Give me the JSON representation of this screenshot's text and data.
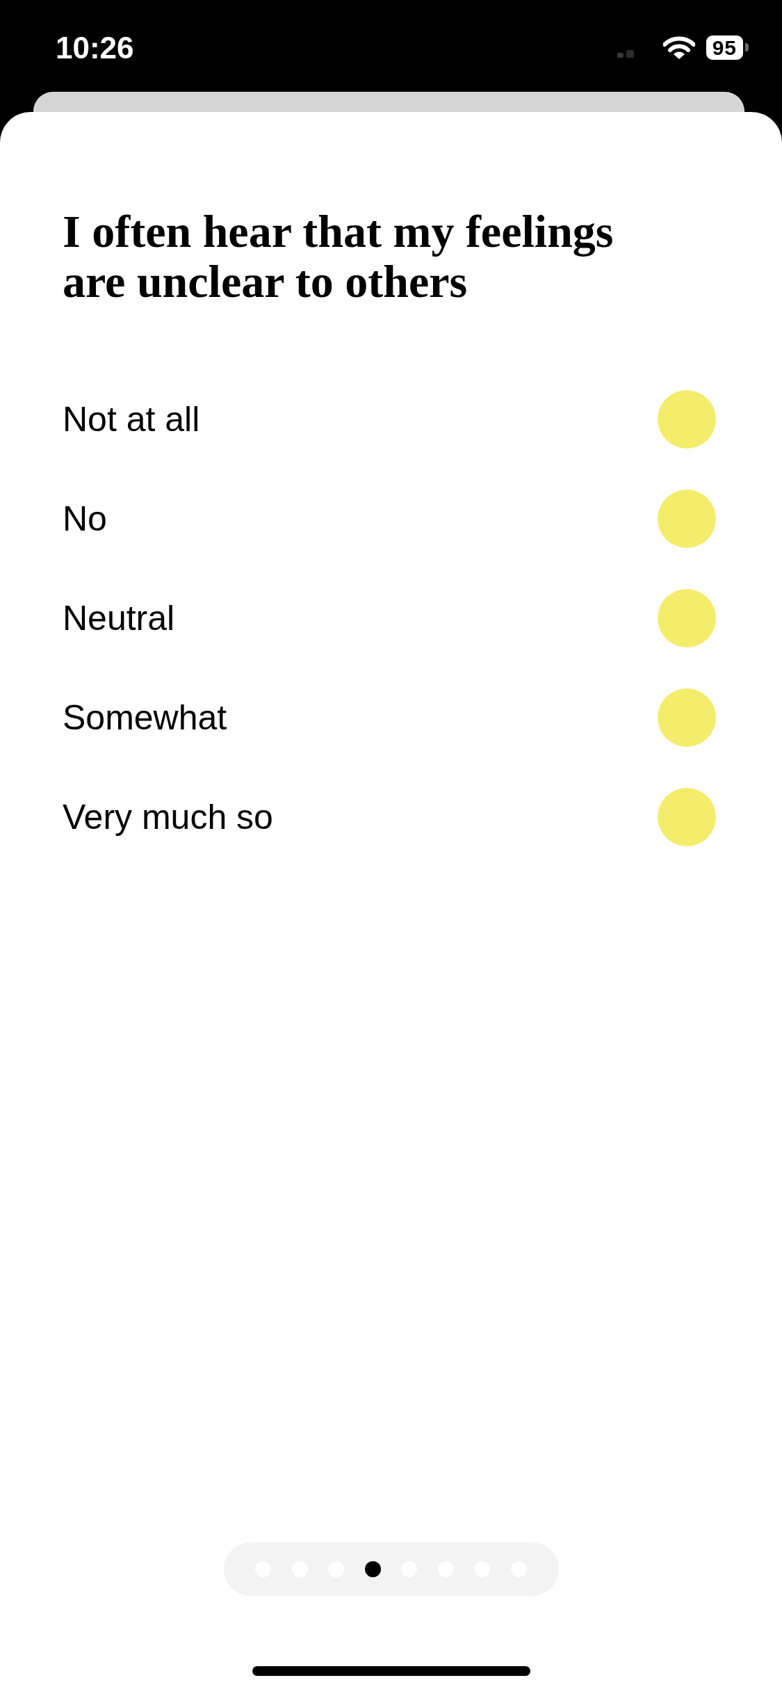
{
  "status_bar": {
    "time": "10:26",
    "battery": "95"
  },
  "question": {
    "title": "I often hear that my feelings are unclear to others"
  },
  "options": [
    {
      "label": "Not at all",
      "selected": false
    },
    {
      "label": "No",
      "selected": false
    },
    {
      "label": "Neutral",
      "selected": false
    },
    {
      "label": "Somewhat",
      "selected": false
    },
    {
      "label": "Very much so",
      "selected": false
    }
  ],
  "pages": [
    {
      "selected": false
    },
    {
      "selected": false
    },
    {
      "selected": false
    },
    {
      "selected": true
    },
    {
      "selected": false
    },
    {
      "selected": false
    },
    {
      "selected": false
    },
    {
      "selected": false
    }
  ]
}
